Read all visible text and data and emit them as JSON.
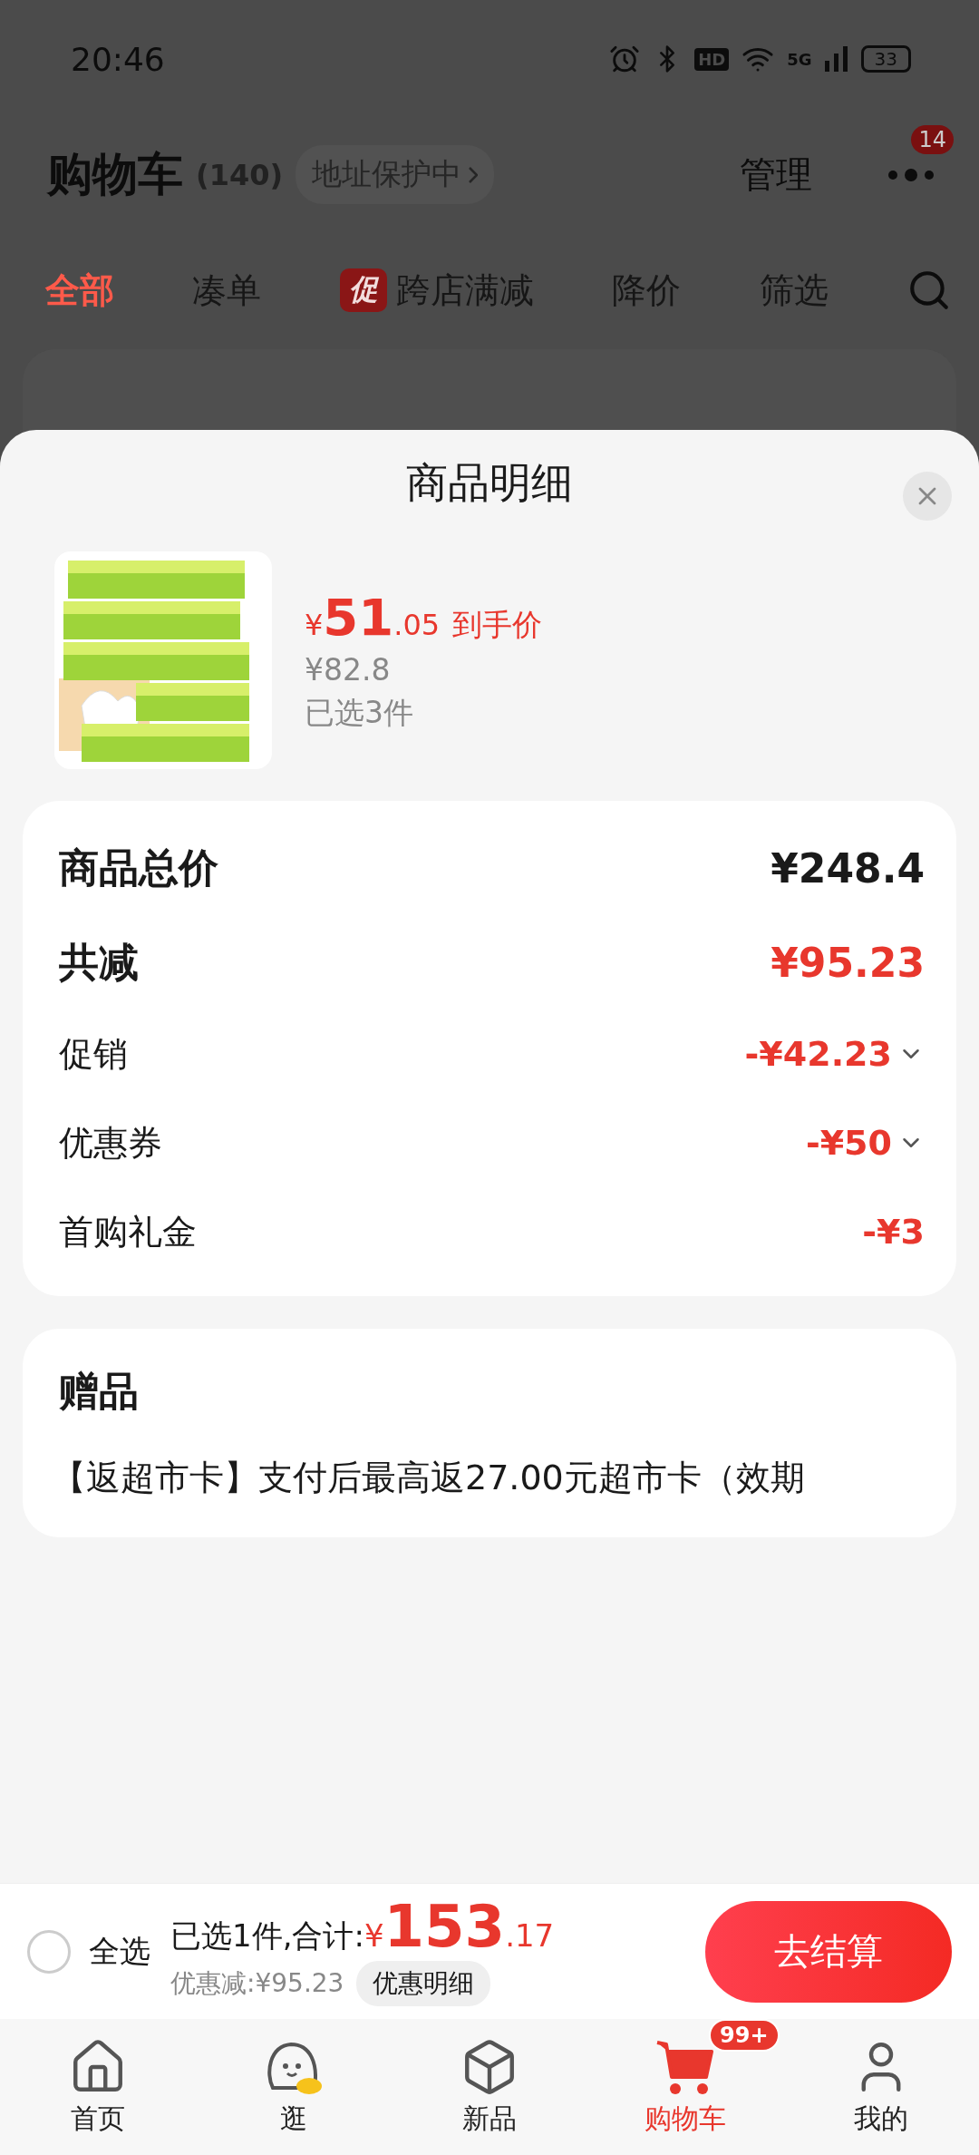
{
  "status_bar": {
    "time": "20:46",
    "hd": "HD",
    "network": "5G",
    "battery": "33"
  },
  "header": {
    "title": "购物车",
    "count": "(140)",
    "address_chip": "地址保护中",
    "manage": "管理",
    "badge": "14"
  },
  "filter_tabs": [
    {
      "label": "全部",
      "selected": true,
      "kind": "text"
    },
    {
      "label": "凑单",
      "selected": false,
      "kind": "text"
    },
    {
      "label": "跨店满减",
      "tag": "促",
      "selected": false,
      "kind": "tagged"
    },
    {
      "label": "降价",
      "selected": false,
      "kind": "text"
    },
    {
      "label": "筛选",
      "selected": false,
      "kind": "text"
    }
  ],
  "sheet": {
    "title": "商品明细",
    "product": {
      "price_symbol": "¥",
      "price_int": "51",
      "price_dec": ".05",
      "price_note": "到手价",
      "original_price": "¥82.8",
      "selected_count": "已选3件"
    },
    "summary": [
      {
        "label": "商品总价",
        "value": "¥248.4",
        "kind": "total",
        "expandable": false
      },
      {
        "label": "共减",
        "value": "¥95.23",
        "kind": "discount_total",
        "expandable": false
      },
      {
        "label": "促销",
        "value": "-¥42.23",
        "kind": "item",
        "expandable": true
      },
      {
        "label": "优惠券",
        "value": "-¥50",
        "kind": "item",
        "expandable": true
      },
      {
        "label": "首购礼金",
        "value": "-¥3",
        "kind": "item",
        "expandable": false
      }
    ],
    "gift": {
      "title": "赠品",
      "text": "【返超市卡】支付后最高返27.00元超市卡（效期"
    }
  },
  "checkout_bar": {
    "select_all": {
      "label": "全选",
      "checked": false
    },
    "summary_label": "已选1件,合计:",
    "total_symbol": "¥",
    "total_int": "153",
    "total_dec": ".17",
    "saved": "优惠减:¥95.23",
    "detail_button": "优惠明细",
    "checkout_button": "去结算"
  },
  "bottom_nav": [
    {
      "label": "首页",
      "selected": false
    },
    {
      "label": "逛",
      "selected": false
    },
    {
      "label": "新品",
      "selected": false
    },
    {
      "label": "购物车",
      "selected": true,
      "badge": "99+"
    },
    {
      "label": "我的",
      "selected": false
    }
  ]
}
